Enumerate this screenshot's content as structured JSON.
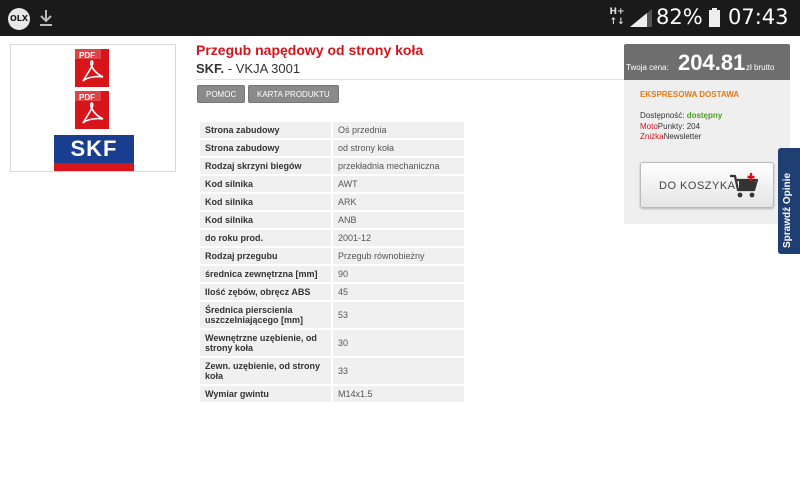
{
  "statusbar": {
    "app_icon_label": "OLX",
    "network_top": "H+",
    "network_arrows": "↑↓",
    "battery_pct": "82%",
    "time": "07:43"
  },
  "product": {
    "title": "Przegub napędowy od strony koła",
    "brand": "SKF.",
    "code": " - VKJA 3001",
    "buttons": {
      "help": "POMOC",
      "card": "KARTA PRODUKTU"
    },
    "images": {
      "pdf_label": "PDF",
      "logo_text": "SKF"
    }
  },
  "specs": [
    {
      "k": "Strona zabudowy",
      "v": "Oś przednia"
    },
    {
      "k": "Strona zabudowy",
      "v": "od strony koła"
    },
    {
      "k": "Rodzaj skrzyni biegów",
      "v": "przekładnia mechaniczna"
    },
    {
      "k": "Kod silnika",
      "v": "AWT"
    },
    {
      "k": "Kod silnika",
      "v": "ARK"
    },
    {
      "k": "Kod silnika",
      "v": "ANB"
    },
    {
      "k": "do roku prod.",
      "v": "2001-12"
    },
    {
      "k": "Rodzaj przegubu",
      "v": "Przegub równobieżny"
    },
    {
      "k": "średnica zewnętrzna [mm]",
      "v": "90"
    },
    {
      "k": "Ilość zębów, obręcz ABS",
      "v": "45"
    },
    {
      "k": "Średnica pierscienia uszczelniającego [mm]",
      "v": "53"
    },
    {
      "k": "Wewnętrzne uzębienie, od strony koła",
      "v": "30"
    },
    {
      "k": "Zewn. uzębienie, od strony koła",
      "v": "33"
    },
    {
      "k": "Wymiar gwintu",
      "v": "M14x1.5"
    }
  ],
  "price": {
    "label": "Twoja cena:",
    "value": "204.81",
    "unit": "zł brutto",
    "express": "EKSPRESOWA DOSTAWA",
    "avail_label": "Dostępność: ",
    "avail_value": "dostępny",
    "moto_red": "Moto",
    "moto_rest": "Punkty: 204",
    "znizka_red": "Zniżka",
    "znizka_rest": "Newsletter",
    "cart_label": "DO KOSZYKA"
  },
  "side_tab": {
    "label": "Sprawdź Opinie"
  },
  "colors": {
    "accent_red": "#d3141b",
    "express_orange": "#e07a16",
    "available_green": "#4aa11d",
    "skf_blue": "#1a3e8f",
    "side_tab_blue": "#1f3f72"
  }
}
